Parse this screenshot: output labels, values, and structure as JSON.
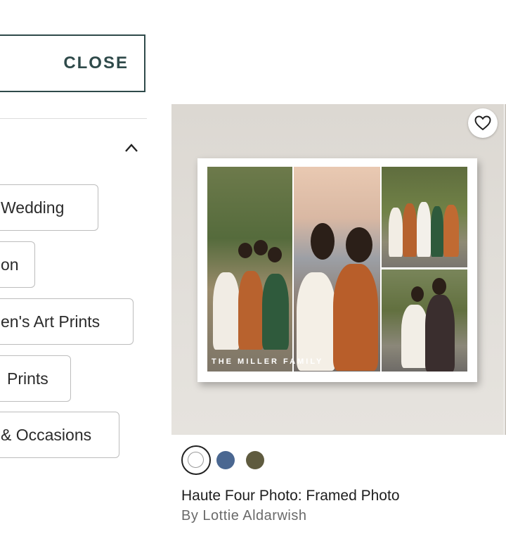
{
  "close_button": {
    "label": "CLOSE"
  },
  "filter_section": {
    "chips": [
      {
        "label": "Wedding"
      },
      {
        "label": "on"
      },
      {
        "label": "en's Art Prints"
      },
      {
        "label": "Prints"
      },
      {
        "label": "& Occasions"
      }
    ]
  },
  "product": {
    "image_overlay_text": "THE MILLER FAMILY",
    "title": "Haute Four Photo: Framed Photo",
    "byline": "By Lottie Aldarwish",
    "swatches": [
      {
        "color": "#ffffff",
        "selected": true
      },
      {
        "color": "#4a6791",
        "selected": false
      },
      {
        "color": "#5f5b3f",
        "selected": false
      }
    ]
  },
  "icons": {
    "favorite": "heart-icon",
    "collapse": "chevron-up-icon"
  }
}
